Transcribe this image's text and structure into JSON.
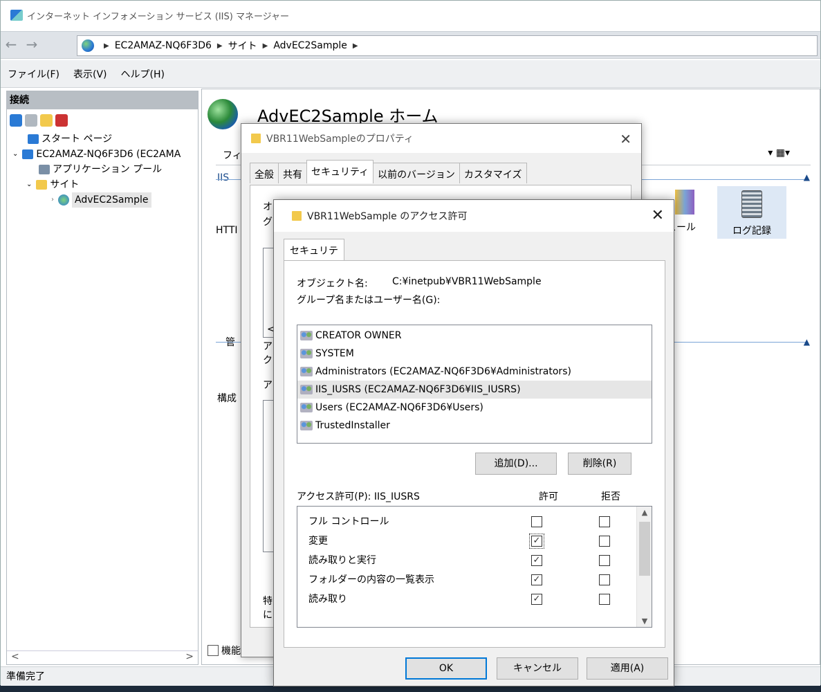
{
  "app": {
    "title": "インターネット インフォメーション サービス (IIS) マネージャー",
    "breadcrumb": [
      "EC2AMAZ-NQ6F3D6",
      "サイト",
      "AdvEC2Sample"
    ],
    "menu": [
      "ファイル(F)",
      "表示(V)",
      "ヘルプ(H)"
    ],
    "status": "準備完了"
  },
  "connections": {
    "header": "接続",
    "tree": [
      {
        "label": "スタート ページ",
        "icon": "start-page-icon"
      },
      {
        "label": "EC2AMAZ-NQ6F3D6 (EC2AMA",
        "icon": "server-icon"
      },
      {
        "label": "アプリケーション プール",
        "icon": "app-pool-icon"
      },
      {
        "label": "サイト",
        "icon": "sites-folder-icon"
      },
      {
        "label": "AdvEC2Sample",
        "icon": "site-globe-icon"
      }
    ],
    "scroll_left": "<",
    "scroll_right": ">"
  },
  "home": {
    "title": "AdvEC2Sample ホーム",
    "fragments": {
      "filter": "フィル",
      "iis": "IIS",
      "http": "HTTI",
      "manage": "管",
      "config": "構成",
      "a1": "ア",
      "ku": "ク",
      "a2": "ア",
      "special": "特",
      "ni": "に("
    },
    "features": {
      "module": "ュール",
      "logging": "ログ記録"
    },
    "view_tab": "機能ビュー"
  },
  "properties_dialog": {
    "title": "VBR11WebSampleのプロパティ",
    "tabs": [
      "全般",
      "共有",
      "セキュリティ",
      "以前のバージョン",
      "カスタマイズ"
    ],
    "active_tab": 2,
    "fragments": {
      "ob": "オ",
      "gu": "グ",
      "lt": "<"
    }
  },
  "permissions_dialog": {
    "title": "VBR11WebSample のアクセス許可",
    "tab": "セキュリティ",
    "object_label": "オブジェクト名:",
    "object_value": "C:¥inetpub¥VBR11WebSample",
    "group_label": "グループ名またはユーザー名(G):",
    "users": [
      "CREATOR OWNER",
      "SYSTEM",
      "Administrators (EC2AMAZ-NQ6F3D6¥Administrators)",
      "IIS_IUSRS (EC2AMAZ-NQ6F3D6¥IIS_IUSRS)",
      "Users (EC2AMAZ-NQ6F3D6¥Users)",
      "TrustedInstaller"
    ],
    "selected_user": 3,
    "add_button": "追加(D)...",
    "remove_button": "削除(R)",
    "perm_label": "アクセス許可(P): IIS_IUSRS",
    "allow_header": "許可",
    "deny_header": "拒否",
    "permissions": [
      {
        "name": "フル コントロール",
        "allow": false,
        "deny": false
      },
      {
        "name": "変更",
        "allow": true,
        "deny": false
      },
      {
        "name": "読み取りと実行",
        "allow": true,
        "deny": false
      },
      {
        "name": "フォルダーの内容の一覧表示",
        "allow": true,
        "deny": false
      },
      {
        "name": "読み取り",
        "allow": true,
        "deny": false
      }
    ],
    "ok": "OK",
    "cancel": "キャンセル",
    "apply": "適用(A)"
  }
}
